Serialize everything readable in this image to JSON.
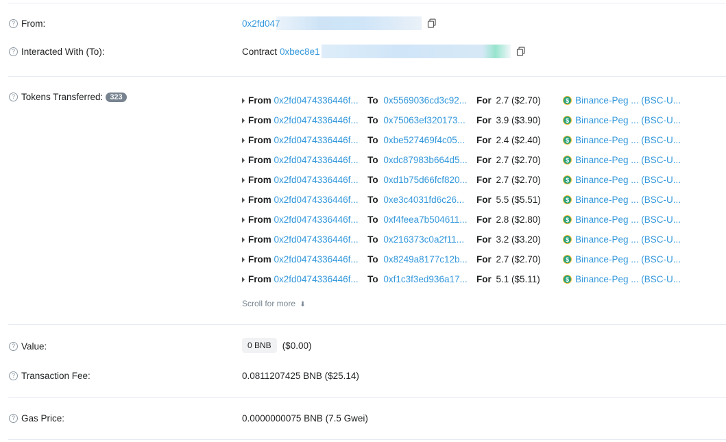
{
  "from": {
    "label": "From:",
    "address": "0x2fd047"
  },
  "interacted": {
    "label": "Interacted With (To):",
    "prefix": "Contract",
    "address": "0xbec8e1"
  },
  "tokens": {
    "label": "Tokens Transferred:",
    "count": "323",
    "from_kw": "From",
    "to_kw": "To",
    "for_kw": "For",
    "rows": [
      {
        "from": "0x2fd0474336446f...",
        "to": "0x5569036cd3c92...",
        "amount": "2.7 ($2.70)",
        "token": "Binance-Peg ...",
        "symbol": "(BSC-U..."
      },
      {
        "from": "0x2fd0474336446f...",
        "to": "0x75063ef320173...",
        "amount": "3.9 ($3.90)",
        "token": "Binance-Peg ...",
        "symbol": "(BSC-U..."
      },
      {
        "from": "0x2fd0474336446f...",
        "to": "0xbe527469f4c05...",
        "amount": "2.4 ($2.40)",
        "token": "Binance-Peg ...",
        "symbol": "(BSC-U..."
      },
      {
        "from": "0x2fd0474336446f...",
        "to": "0xdc87983b664d5...",
        "amount": "2.7 ($2.70)",
        "token": "Binance-Peg ...",
        "symbol": "(BSC-U..."
      },
      {
        "from": "0x2fd0474336446f...",
        "to": "0xd1b75d66fcf820...",
        "amount": "2.7 ($2.70)",
        "token": "Binance-Peg ...",
        "symbol": "(BSC-U..."
      },
      {
        "from": "0x2fd0474336446f...",
        "to": "0xe3c4031fd6c26...",
        "amount": "5.5 ($5.51)",
        "token": "Binance-Peg ...",
        "symbol": "(BSC-U..."
      },
      {
        "from": "0x2fd0474336446f...",
        "to": "0xf4feea7b504611...",
        "amount": "2.8 ($2.80)",
        "token": "Binance-Peg ...",
        "symbol": "(BSC-U..."
      },
      {
        "from": "0x2fd0474336446f...",
        "to": "0x216373c0a2f11...",
        "amount": "3.2 ($3.20)",
        "token": "Binance-Peg ...",
        "symbol": "(BSC-U..."
      },
      {
        "from": "0x2fd0474336446f...",
        "to": "0x8249a8177c12b...",
        "amount": "2.7 ($2.70)",
        "token": "Binance-Peg ...",
        "symbol": "(BSC-U..."
      },
      {
        "from": "0x2fd0474336446f...",
        "to": "0xf1c3f3ed936a17...",
        "amount": "5.1 ($5.11)",
        "token": "Binance-Peg ...",
        "symbol": "(BSC-U..."
      }
    ],
    "scroll_more": "Scroll for more"
  },
  "value": {
    "label": "Value:",
    "badge": "0 BNB",
    "usd": "($0.00)"
  },
  "fee": {
    "label": "Transaction Fee:",
    "text": "0.0811207425 BNB ($25.14)"
  },
  "gas": {
    "label": "Gas Price:",
    "text": "0.0000000075 BNB (7.5 Gwei)"
  },
  "colors": {
    "link": "#3498db",
    "badge": "#77838f",
    "coin": "#26a17b"
  }
}
